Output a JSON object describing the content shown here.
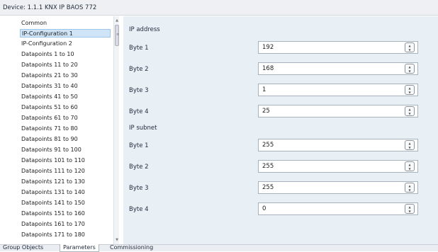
{
  "titlebar": {
    "device_label": "Device: 1.1.1  KNX IP BAOS 772"
  },
  "tree": {
    "items": [
      {
        "label": "Common"
      },
      {
        "label": "IP-Configuration 1"
      },
      {
        "label": "IP-Configuration 2"
      },
      {
        "label": "Datapoints 1 to 10"
      },
      {
        "label": "Datapoints 11 to 20"
      },
      {
        "label": "Datapoints 21 to 30"
      },
      {
        "label": "Datapoints 31 to 40"
      },
      {
        "label": "Datapoints 41 to 50"
      },
      {
        "label": "Datapoints 51 to 60"
      },
      {
        "label": "Datapoints 61 to 70"
      },
      {
        "label": "Datapoints 71 to 80"
      },
      {
        "label": "Datapoints 81 to 90"
      },
      {
        "label": "Datapoints 91 to 100"
      },
      {
        "label": "Datapoints 101 to 110"
      },
      {
        "label": "Datapoints 111 to 120"
      },
      {
        "label": "Datapoints 121 to 130"
      },
      {
        "label": "Datapoints 131 to 140"
      },
      {
        "label": "Datapoints 141 to 150"
      },
      {
        "label": "Datapoints 151 to 160"
      },
      {
        "label": "Datapoints 161 to 170"
      },
      {
        "label": "Datapoints 171 to 180"
      }
    ],
    "selected_index": 1
  },
  "sections": [
    {
      "title": "IP address",
      "fields": [
        {
          "label": "Byte 1",
          "value": "192"
        },
        {
          "label": "Byte 2",
          "value": "168"
        },
        {
          "label": "Byte 3",
          "value": "1"
        },
        {
          "label": "Byte 4",
          "value": "25"
        }
      ]
    },
    {
      "title": "IP subnet",
      "fields": [
        {
          "label": "Byte 1",
          "value": "255"
        },
        {
          "label": "Byte 2",
          "value": "255"
        },
        {
          "label": "Byte 3",
          "value": "255"
        },
        {
          "label": "Byte 4",
          "value": "0"
        }
      ]
    }
  ],
  "tabs": [
    {
      "label": "Group Objects"
    },
    {
      "label": "Parameters"
    },
    {
      "label": "Commissioning"
    }
  ],
  "active_tab_index": 1,
  "icons": {
    "spinner": "spinner-icon",
    "scroll_up": "scroll-up-arrow-icon",
    "scroll_down": "scroll-down-arrow-icon",
    "thumb_grip": "scroll-thumb-grip-icon"
  }
}
